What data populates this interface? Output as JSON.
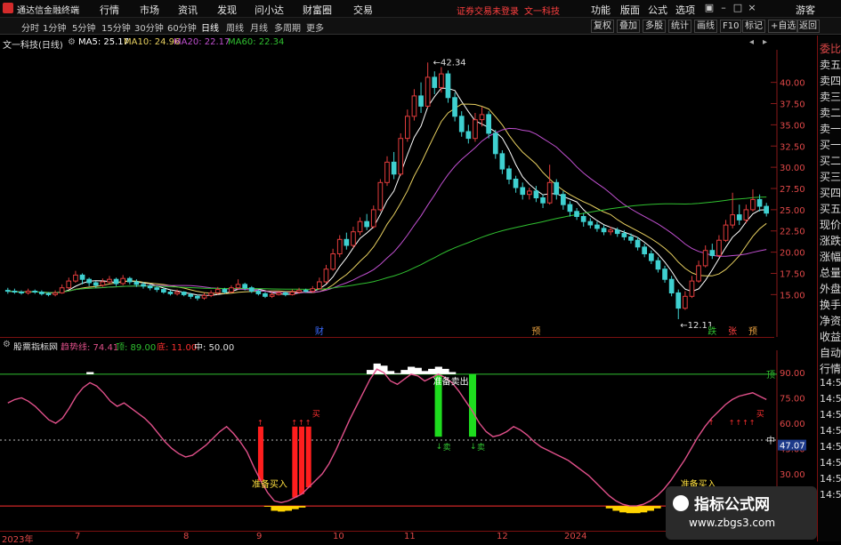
{
  "app": {
    "title": "通达信金融终端"
  },
  "menu": [
    "行情",
    "市场",
    "资讯",
    "发现",
    "问小达",
    "财富圈",
    "交易"
  ],
  "alert_text": "证券交易未登录",
  "stock_header": "文一科技",
  "right_menu": [
    "功能",
    "版面",
    "公式",
    "选项"
  ],
  "login_label": "游客",
  "tabs": [
    "分时",
    "1分钟",
    "5分钟",
    "15分钟",
    "30分钟",
    "60分钟",
    "日线",
    "周线",
    "月线",
    "多周期",
    "更多"
  ],
  "active_tab": "日线",
  "right_buttons": [
    "复权",
    "叠加",
    "多股",
    "统计",
    "画线",
    "F10",
    "标记",
    "+自选",
    "返回"
  ],
  "info": {
    "stock_label": "文一科技(日线)",
    "ma5": "MA5: 25.17",
    "ma10": "MA10: 24.96",
    "ma20": "MA20: 22.17",
    "ma60": "MA60: 22.34"
  },
  "price_axis": [
    "40.00",
    "37.50",
    "35.00",
    "32.50",
    "30.00",
    "27.50",
    "25.00",
    "22.50",
    "20.00",
    "17.50",
    "15.00"
  ],
  "price_markers": {
    "high": "42.34",
    "low": "12.11"
  },
  "chart_markers": [
    "财",
    "预",
    "跌",
    "张",
    "预"
  ],
  "indicator": {
    "name": "股票指标网",
    "trend": "趋势线: 74.41",
    "top": "顶: 89.00",
    "bottom": "底: 11.00",
    "mid": "中: 50.00",
    "axis": [
      "90.00",
      "75.00",
      "60.00",
      "45.00",
      "30.00"
    ],
    "mid_right": "中",
    "top_right": "顶",
    "current_badge": "47.07",
    "signals": {
      "prepare_buy": "准备买入",
      "prepare_sell": "准备卖出",
      "buy": "买",
      "sell": "卖"
    }
  },
  "dates": [
    "2023年",
    "7",
    "8",
    "9",
    "10",
    "11",
    "12",
    "2024"
  ],
  "side_panel": [
    "委比",
    "卖五",
    "卖四",
    "卖三",
    "卖二",
    "卖一",
    "买一",
    "买二",
    "买三",
    "买四",
    "买五",
    "现价",
    "涨跌",
    "涨幅",
    "总量",
    "外盘",
    "换手",
    "净资",
    "收益",
    "自动",
    "行情",
    "14:5",
    "14:5",
    "14:5",
    "14:5",
    "14:5",
    "14:5",
    "14:5",
    "14:5"
  ],
  "watermark": {
    "title": "指标公式网",
    "url": "www.zbgs3.com"
  },
  "colors": {
    "up": "#e23c3c",
    "down": "#3fd0d0",
    "ma5": "#ffffff",
    "ma10": "#e8d060",
    "ma20": "#c050d0",
    "ma60": "#30c030",
    "trend": "#e0508a",
    "buy_bar": "#ff1e1e",
    "sell_bar": "#1edc1e"
  },
  "chart_data": {
    "type": "candlestick",
    "ylim": [
      12,
      43
    ],
    "candles": [
      [
        15.5,
        15.4,
        15.8,
        15.1
      ],
      [
        15.4,
        15.3,
        15.7,
        15.1
      ],
      [
        15.3,
        15.2,
        15.5,
        15.0
      ],
      [
        15.2,
        15.4,
        15.7,
        15.0
      ],
      [
        15.4,
        15.3,
        15.6,
        15.1
      ],
      [
        15.3,
        15.1,
        15.5,
        14.9
      ],
      [
        15.1,
        15.0,
        15.3,
        14.8
      ],
      [
        15.0,
        15.2,
        15.5,
        14.8
      ],
      [
        15.2,
        15.8,
        16.2,
        15.1
      ],
      [
        15.8,
        16.6,
        17.0,
        15.6
      ],
      [
        16.6,
        17.3,
        17.8,
        16.4
      ],
      [
        17.3,
        16.8,
        17.5,
        16.2
      ],
      [
        16.8,
        16.4,
        17.0,
        16.0
      ],
      [
        16.4,
        16.1,
        16.6,
        15.8
      ],
      [
        16.1,
        16.5,
        16.9,
        15.9
      ],
      [
        16.5,
        16.8,
        17.2,
        16.3
      ],
      [
        16.8,
        16.3,
        17.0,
        16.0
      ],
      [
        16.3,
        16.9,
        17.3,
        16.1
      ],
      [
        16.9,
        16.5,
        17.1,
        16.2
      ],
      [
        16.5,
        16.2,
        16.8,
        15.9
      ],
      [
        16.2,
        16.0,
        16.5,
        15.7
      ],
      [
        16.0,
        15.8,
        16.2,
        15.5
      ],
      [
        15.8,
        15.6,
        16.0,
        15.3
      ],
      [
        15.6,
        15.3,
        15.8,
        15.1
      ],
      [
        15.3,
        15.1,
        15.5,
        14.9
      ],
      [
        15.1,
        15.3,
        15.6,
        14.9
      ],
      [
        15.3,
        15.0,
        15.4,
        14.8
      ],
      [
        15.0,
        14.8,
        15.2,
        14.5
      ],
      [
        14.8,
        14.6,
        15.0,
        14.3
      ],
      [
        14.6,
        14.9,
        15.2,
        14.4
      ],
      [
        14.9,
        15.2,
        15.5,
        14.7
      ],
      [
        15.2,
        15.6,
        15.9,
        15.0
      ],
      [
        15.6,
        15.3,
        15.8,
        15.1
      ],
      [
        15.3,
        15.8,
        16.1,
        15.2
      ],
      [
        15.8,
        16.2,
        16.8,
        15.6
      ],
      [
        16.2,
        15.8,
        16.4,
        15.5
      ],
      [
        15.8,
        15.4,
        16.0,
        15.2
      ],
      [
        15.4,
        15.1,
        15.6,
        14.9
      ],
      [
        15.1,
        14.8,
        15.3,
        14.6
      ],
      [
        14.8,
        15.0,
        15.3,
        14.6
      ],
      [
        15.0,
        15.2,
        15.4,
        14.9
      ],
      [
        15.2,
        15.0,
        15.4,
        14.8
      ],
      [
        15.0,
        15.3,
        15.6,
        14.9
      ],
      [
        15.3,
        15.5,
        15.8,
        15.1
      ],
      [
        15.5,
        15.4,
        15.7,
        15.2
      ],
      [
        15.4,
        15.7,
        16.0,
        15.2
      ],
      [
        15.7,
        16.5,
        17.0,
        15.6
      ],
      [
        16.5,
        18.0,
        18.5,
        16.3
      ],
      [
        18.0,
        19.8,
        20.4,
        17.8
      ],
      [
        19.8,
        21.5,
        22.0,
        19.4
      ],
      [
        21.5,
        20.8,
        22.3,
        20.3
      ],
      [
        20.8,
        22.4,
        23.0,
        20.5
      ],
      [
        22.4,
        23.6,
        24.1,
        22.0
      ],
      [
        23.6,
        23.0,
        24.5,
        22.6
      ],
      [
        23.0,
        25.0,
        25.5,
        22.8
      ],
      [
        25.0,
        28.2,
        28.6,
        24.8
      ],
      [
        28.2,
        30.6,
        31.3,
        27.8
      ],
      [
        30.6,
        29.2,
        31.8,
        28.6
      ],
      [
        29.2,
        33.4,
        34.0,
        29.0
      ],
      [
        33.4,
        36.0,
        36.8,
        33.0
      ],
      [
        36.0,
        38.4,
        39.2,
        35.5
      ],
      [
        38.4,
        37.2,
        40.0,
        36.4
      ],
      [
        37.2,
        40.6,
        42.34,
        37.0
      ],
      [
        40.6,
        39.4,
        41.3,
        38.6
      ],
      [
        39.4,
        41.0,
        41.8,
        38.8
      ],
      [
        41.0,
        38.2,
        41.4,
        37.6
      ],
      [
        38.2,
        36.0,
        38.8,
        35.4
      ],
      [
        36.0,
        34.2,
        36.6,
        33.6
      ],
      [
        34.2,
        33.4,
        35.0,
        32.8
      ],
      [
        33.4,
        35.6,
        36.4,
        33.0
      ],
      [
        35.6,
        36.2,
        37.1,
        34.8
      ],
      [
        36.2,
        34.0,
        36.6,
        33.4
      ],
      [
        34.0,
        31.6,
        34.4,
        31.0
      ],
      [
        31.6,
        29.8,
        32.0,
        29.2
      ],
      [
        29.8,
        28.6,
        30.2,
        28.0
      ],
      [
        28.6,
        27.6,
        29.0,
        27.0
      ],
      [
        27.6,
        26.8,
        28.2,
        26.2
      ],
      [
        26.8,
        27.2,
        27.6,
        26.2
      ],
      [
        27.2,
        26.4,
        27.8,
        25.9
      ],
      [
        26.4,
        25.8,
        26.8,
        25.2
      ],
      [
        25.8,
        28.2,
        30.3,
        25.6
      ],
      [
        28.2,
        26.8,
        28.6,
        26.2
      ],
      [
        26.8,
        25.6,
        27.2,
        25.0
      ],
      [
        25.6,
        24.8,
        26.0,
        24.2
      ],
      [
        24.8,
        24.2,
        25.2,
        23.8
      ],
      [
        24.2,
        23.6,
        24.6,
        23.0
      ],
      [
        23.6,
        23.2,
        24.0,
        22.8
      ],
      [
        23.2,
        22.8,
        23.6,
        22.4
      ],
      [
        22.8,
        22.4,
        23.2,
        22.0
      ],
      [
        22.4,
        22.6,
        23.0,
        22.0
      ],
      [
        22.6,
        22.2,
        22.9,
        21.8
      ],
      [
        22.2,
        21.8,
        22.6,
        21.4
      ],
      [
        21.8,
        21.4,
        22.2,
        21.0
      ],
      [
        21.4,
        20.6,
        21.8,
        20.2
      ],
      [
        20.6,
        19.8,
        21.0,
        19.4
      ],
      [
        19.8,
        19.0,
        20.2,
        18.6
      ],
      [
        19.0,
        18.0,
        19.4,
        17.6
      ],
      [
        18.0,
        16.8,
        18.4,
        16.4
      ],
      [
        16.8,
        15.2,
        17.2,
        14.8
      ],
      [
        15.2,
        13.4,
        15.6,
        12.11
      ],
      [
        13.4,
        14.8,
        15.4,
        13.2
      ],
      [
        14.8,
        16.6,
        17.2,
        14.6
      ],
      [
        16.6,
        18.4,
        19.0,
        16.4
      ],
      [
        18.4,
        20.2,
        20.8,
        18.2
      ],
      [
        20.2,
        19.6,
        21.0,
        19.2
      ],
      [
        19.6,
        21.4,
        22.0,
        19.4
      ],
      [
        21.4,
        23.2,
        23.8,
        21.2
      ],
      [
        23.2,
        24.4,
        27.0,
        22.8
      ],
      [
        24.4,
        23.8,
        25.6,
        23.2
      ],
      [
        23.8,
        25.0,
        25.6,
        23.4
      ],
      [
        25.0,
        26.2,
        27.4,
        24.8
      ],
      [
        26.2,
        25.4,
        26.8,
        24.8
      ],
      [
        25.4,
        24.6,
        25.8,
        24.2
      ]
    ],
    "oscillator": [
      72,
      74,
      75,
      73,
      70,
      66,
      62,
      60,
      63,
      69,
      76,
      81,
      84,
      82,
      78,
      73,
      70,
      72,
      69,
      66,
      63,
      59,
      54,
      49,
      45,
      42,
      40,
      41,
      44,
      47,
      51,
      55,
      58,
      54,
      49,
      43,
      34,
      26,
      19,
      14,
      13,
      14,
      16,
      18,
      22,
      26,
      30,
      36,
      44,
      53,
      62,
      70,
      78,
      86,
      92,
      90,
      85,
      83,
      86,
      89,
      88,
      85,
      87,
      89,
      87,
      84,
      79,
      73,
      67,
      60,
      55,
      52,
      53,
      55,
      58,
      56,
      53,
      49,
      46,
      44,
      42,
      40,
      38,
      35,
      32,
      29,
      25,
      21,
      17,
      14,
      12,
      11,
      11,
      12,
      14,
      17,
      21,
      26,
      32,
      38,
      45,
      52,
      58,
      63,
      67,
      71,
      74,
      76,
      77,
      78,
      76,
      74
    ],
    "levels": {
      "top": 89,
      "bottom": 11,
      "mid": 50
    },
    "oscillator_ylim": [
      0,
      100
    ]
  }
}
